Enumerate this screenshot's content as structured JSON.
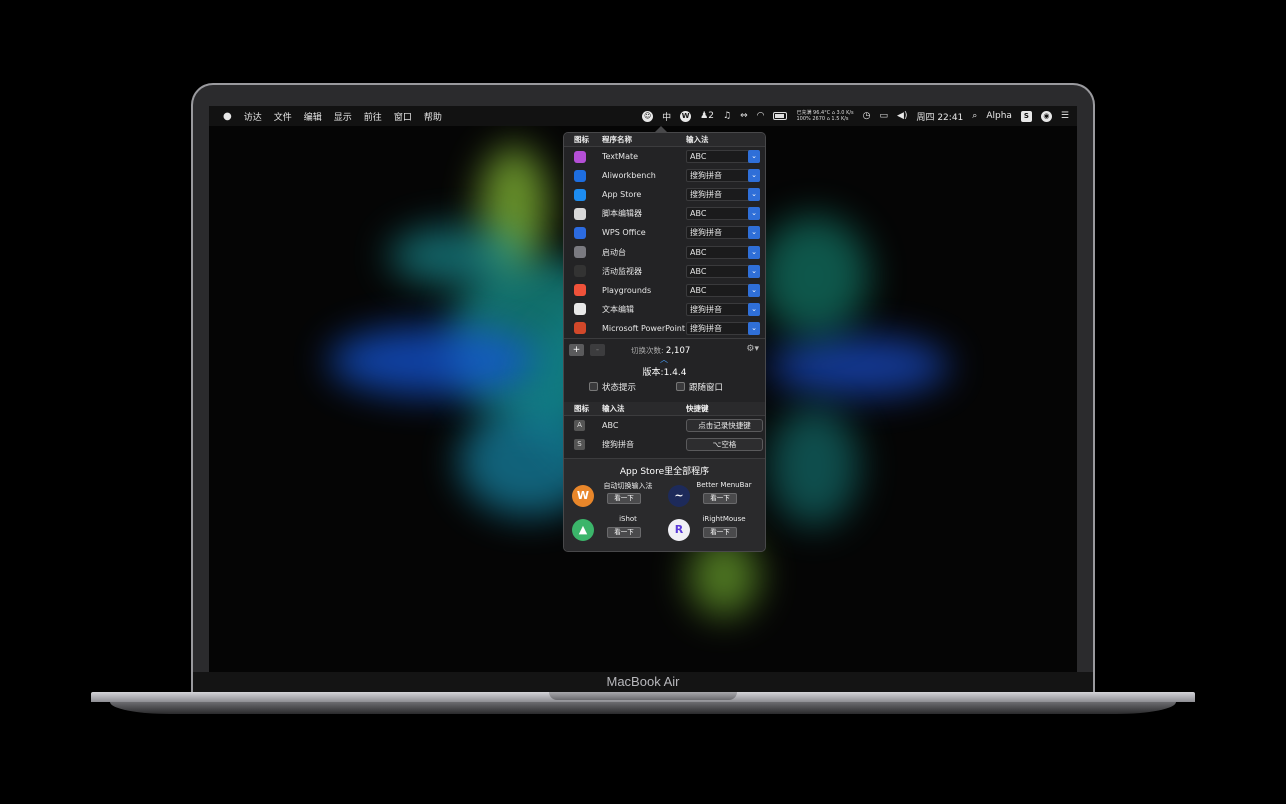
{
  "device": {
    "label": "MacBook Air"
  },
  "menubar": {
    "apple": "",
    "menus": [
      "访达",
      "文件",
      "编辑",
      "显示",
      "前往",
      "窗口",
      "帮助"
    ],
    "status": {
      "ime": "中",
      "qq_count": "2",
      "stats_line1": "已充满 96.4°C ⌂ 3.0 K/s",
      "stats_line2": "100% 2670 ⌂ 1.5 K/s",
      "clock": "周四 22:41",
      "alpha": "Alpha"
    }
  },
  "popover": {
    "table_headers": {
      "icon": "图标",
      "program": "程序名称",
      "ime": "输入法"
    },
    "apps": [
      {
        "name": "TextMate",
        "ime": "ABC",
        "icon": "textmate-icon",
        "color": "#b44fd6"
      },
      {
        "name": "Aliworkbench",
        "ime": "搜狗拼音",
        "icon": "aliworkbench-icon",
        "color": "#1e6ee0"
      },
      {
        "name": "App Store",
        "ime": "搜狗拼音",
        "icon": "app-store-icon",
        "color": "#1d8cf0"
      },
      {
        "name": "脚本编辑器",
        "ime": "ABC",
        "icon": "script-editor-icon",
        "color": "#d8d8d8"
      },
      {
        "name": "WPS Office",
        "ime": "搜狗拼音",
        "icon": "wps-office-icon",
        "color": "#2c6be0"
      },
      {
        "name": "启动台",
        "ime": "ABC",
        "icon": "launchpad-icon",
        "color": "#7a7a80"
      },
      {
        "name": "活动监视器",
        "ime": "ABC",
        "icon": "activity-monitor-icon",
        "color": "#333"
      },
      {
        "name": "Playgrounds",
        "ime": "ABC",
        "icon": "playgrounds-icon",
        "color": "#f0523a"
      },
      {
        "name": "文本编辑",
        "ime": "搜狗拼音",
        "icon": "textedit-icon",
        "color": "#e8e8e8"
      },
      {
        "name": "Microsoft PowerPoint",
        "ime": "搜狗拼音",
        "icon": "powerpoint-icon",
        "color": "#d2482a"
      }
    ],
    "add_label": "+",
    "remove_label": "-",
    "switch_count_label": "切换次数:",
    "switch_count": "2,107",
    "version": "版本:1.4.4",
    "checkbox_status": "状态提示",
    "checkbox_follow": "跟随窗口",
    "ime_headers": {
      "icon": "图标",
      "ime": "输入法",
      "shortcut": "快捷键"
    },
    "ime_list": [
      {
        "name": "ABC",
        "shortcut": "点击记录快捷键",
        "glyph": "A"
      },
      {
        "name": "搜狗拼音",
        "shortcut": "⌥空格",
        "glyph": "S"
      }
    ],
    "promo": {
      "title": "App Store里全部程序",
      "button_label": "看一下",
      "items": [
        {
          "name": "自动切换输入法",
          "color": "#e8862a",
          "glyph": "W"
        },
        {
          "name": "Better MenuBar",
          "color": "#1d2a5a",
          "glyph": "~"
        },
        {
          "name": "iShot",
          "color": "#3bb56a",
          "glyph": "▲"
        },
        {
          "name": "iRightMouse",
          "color": "#f0f0f5",
          "glyph": "R"
        }
      ]
    }
  }
}
